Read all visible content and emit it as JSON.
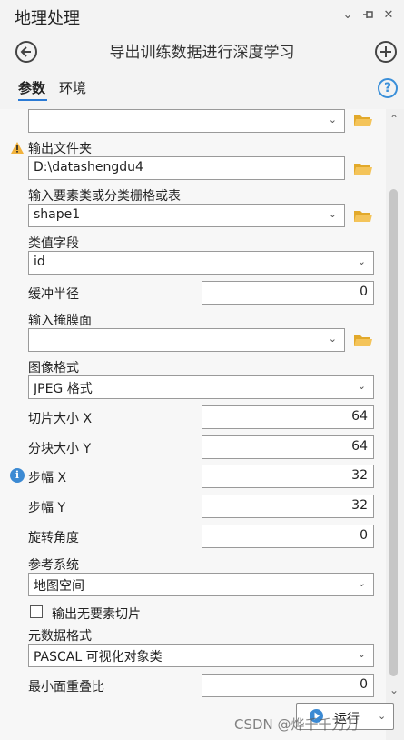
{
  "window": {
    "title": "地理处理",
    "controls": [
      "chevron-down-icon",
      "pin-icon",
      "close-icon"
    ]
  },
  "tool": {
    "title": "导出训练数据进行深度学习"
  },
  "tabs": [
    {
      "label": "参数",
      "active": true
    },
    {
      "label": "环境",
      "active": false
    }
  ],
  "params": {
    "top_dropdown": {
      "value": ""
    },
    "output_folder": {
      "label": "输出文件夹",
      "value": "D:\\datashengdu4",
      "warning": true
    },
    "input_features": {
      "label": "输入要素类或分类栅格或表",
      "value": "shape1"
    },
    "class_field": {
      "label": "类值字段",
      "value": "id"
    },
    "buffer_radius": {
      "label": "缓冲半径",
      "value": "0"
    },
    "mask": {
      "label": "输入掩膜面",
      "value": ""
    },
    "image_format": {
      "label": "图像格式",
      "value": "JPEG 格式"
    },
    "tile_size_x": {
      "label": "切片大小 X",
      "value": "64"
    },
    "tile_size_y": {
      "label": "分块大小 Y",
      "value": "64"
    },
    "stride_x": {
      "label": "步幅 X",
      "value": "32",
      "info": true
    },
    "stride_y": {
      "label": "步幅 Y",
      "value": "32"
    },
    "rotation": {
      "label": "旋转角度",
      "value": "0"
    },
    "reference_system": {
      "label": "参考系统",
      "value": "地图空间"
    },
    "output_no_feature_tiles": {
      "label": "输出无要素切片",
      "checked": false
    },
    "metadata_format": {
      "label": "元数据格式",
      "value": "PASCAL 可视化对象类"
    },
    "min_overlap": {
      "label": "最小面重叠比",
      "value": "0"
    }
  },
  "run": {
    "label": "运行"
  },
  "watermark": "CSDN @烨千千万万",
  "colors": {
    "accent": "#2a7ad5",
    "folder": "#e2a92b",
    "warning": "#f1b23c",
    "info": "#3c8ad3"
  }
}
